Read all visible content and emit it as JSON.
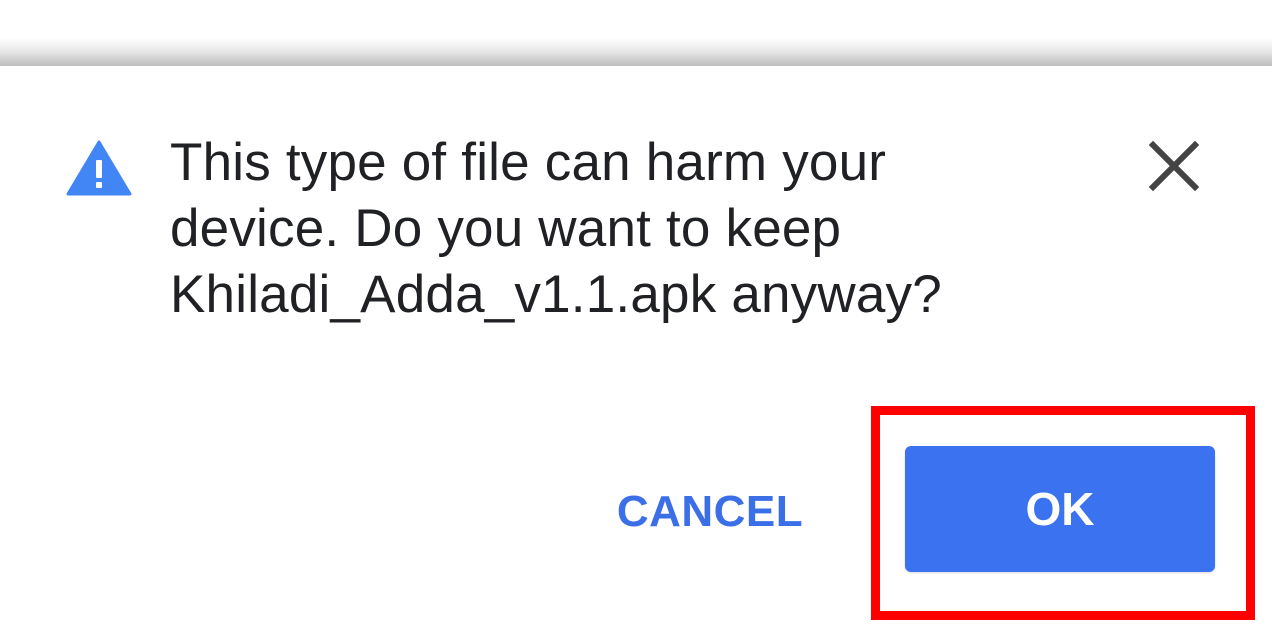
{
  "dialog": {
    "message_lines": [
      "This type of file can harm your",
      "device. Do you want to keep",
      "Khiladi_Adda_v1.1.apk anyway?"
    ],
    "icon": "warning-icon",
    "close_icon": "close-icon",
    "cancel_label": "CANCEL",
    "ok_label": "OK"
  },
  "colors": {
    "accent": "#3a72f0",
    "warning_icon": "#4285f4",
    "text": "#202124",
    "highlight": "#ff0000"
  }
}
